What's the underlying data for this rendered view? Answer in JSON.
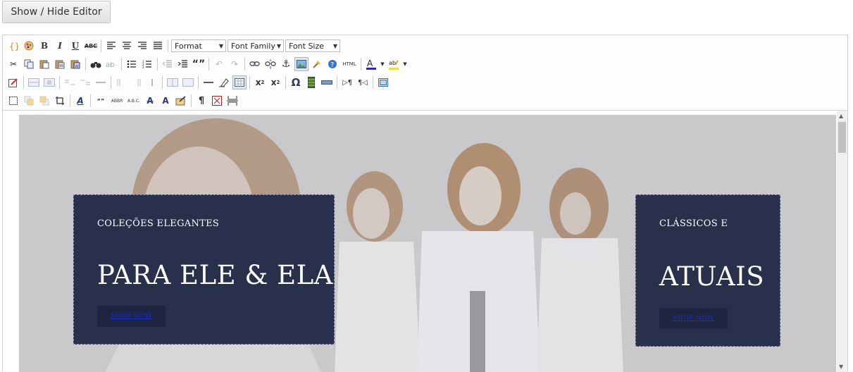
{
  "show_hide_label": "Show / Hide Editor",
  "toolbar": {
    "format_label": "Format",
    "font_family_label": "Font Family",
    "font_size_label": "Font Size",
    "html_label": "HTML",
    "abbr_label": "ABBR",
    "acronym_label": "A.B.C.",
    "quote_label": "“”"
  },
  "hero": {
    "card_left": {
      "pre": "COLEÇÕES ELEGANTES",
      "title": "PARA ELE & ELA",
      "cta": "SHOP NOW"
    },
    "card_right": {
      "pre": "CLÁSSICOS E",
      "title": "ATUAIS",
      "cta": "SHOP NOW"
    },
    "overlay_color": "#c9c9cb",
    "card_color": "#28304c",
    "link_color": "#1a2cd6"
  }
}
